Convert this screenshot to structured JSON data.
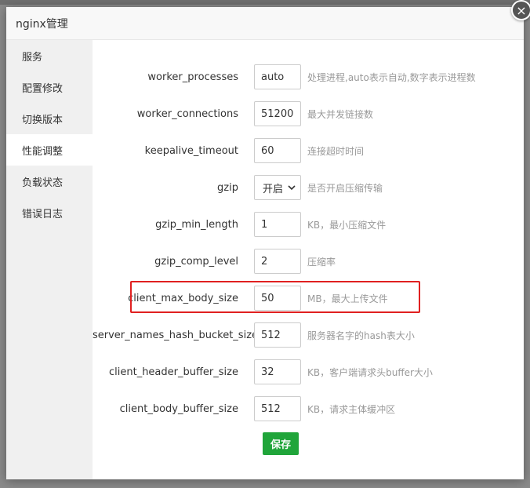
{
  "dialog": {
    "title": "nginx管理",
    "close_icon": "×"
  },
  "sidebar": {
    "items": [
      {
        "label": "服务",
        "active": false
      },
      {
        "label": "配置修改",
        "active": false
      },
      {
        "label": "切换版本",
        "active": false
      },
      {
        "label": "性能调整",
        "active": true
      },
      {
        "label": "负载状态",
        "active": false
      },
      {
        "label": "错误日志",
        "active": false
      }
    ]
  },
  "form": {
    "rows": [
      {
        "label": "worker_processes",
        "value": "auto",
        "hint": "处理进程,auto表示自动,数字表示进程数"
      },
      {
        "label": "worker_connections",
        "value": "51200",
        "hint": "最大并发链接数"
      },
      {
        "label": "keepalive_timeout",
        "value": "60",
        "hint": "连接超时时间"
      },
      {
        "label": "gzip",
        "value": "开启",
        "hint": "是否开启压缩传输",
        "type": "select"
      },
      {
        "label": "gzip_min_length",
        "value": "1",
        "hint": "KB，最小压缩文件"
      },
      {
        "label": "gzip_comp_level",
        "value": "2",
        "hint": "压缩率"
      },
      {
        "label": "client_max_body_size",
        "value": "50",
        "hint": "MB，最大上传文件"
      },
      {
        "label": "server_names_hash_bucket_size",
        "value": "512",
        "hint": "服务器名字的hash表大小"
      },
      {
        "label": "client_header_buffer_size",
        "value": "32",
        "hint": "KB，客户端请求头buffer大小"
      },
      {
        "label": "client_body_buffer_size",
        "value": "512",
        "hint": "KB，请求主体缓冲区"
      }
    ],
    "save_label": "保存"
  },
  "colors": {
    "save_button": "#20a53a",
    "highlight": "#e02020"
  }
}
